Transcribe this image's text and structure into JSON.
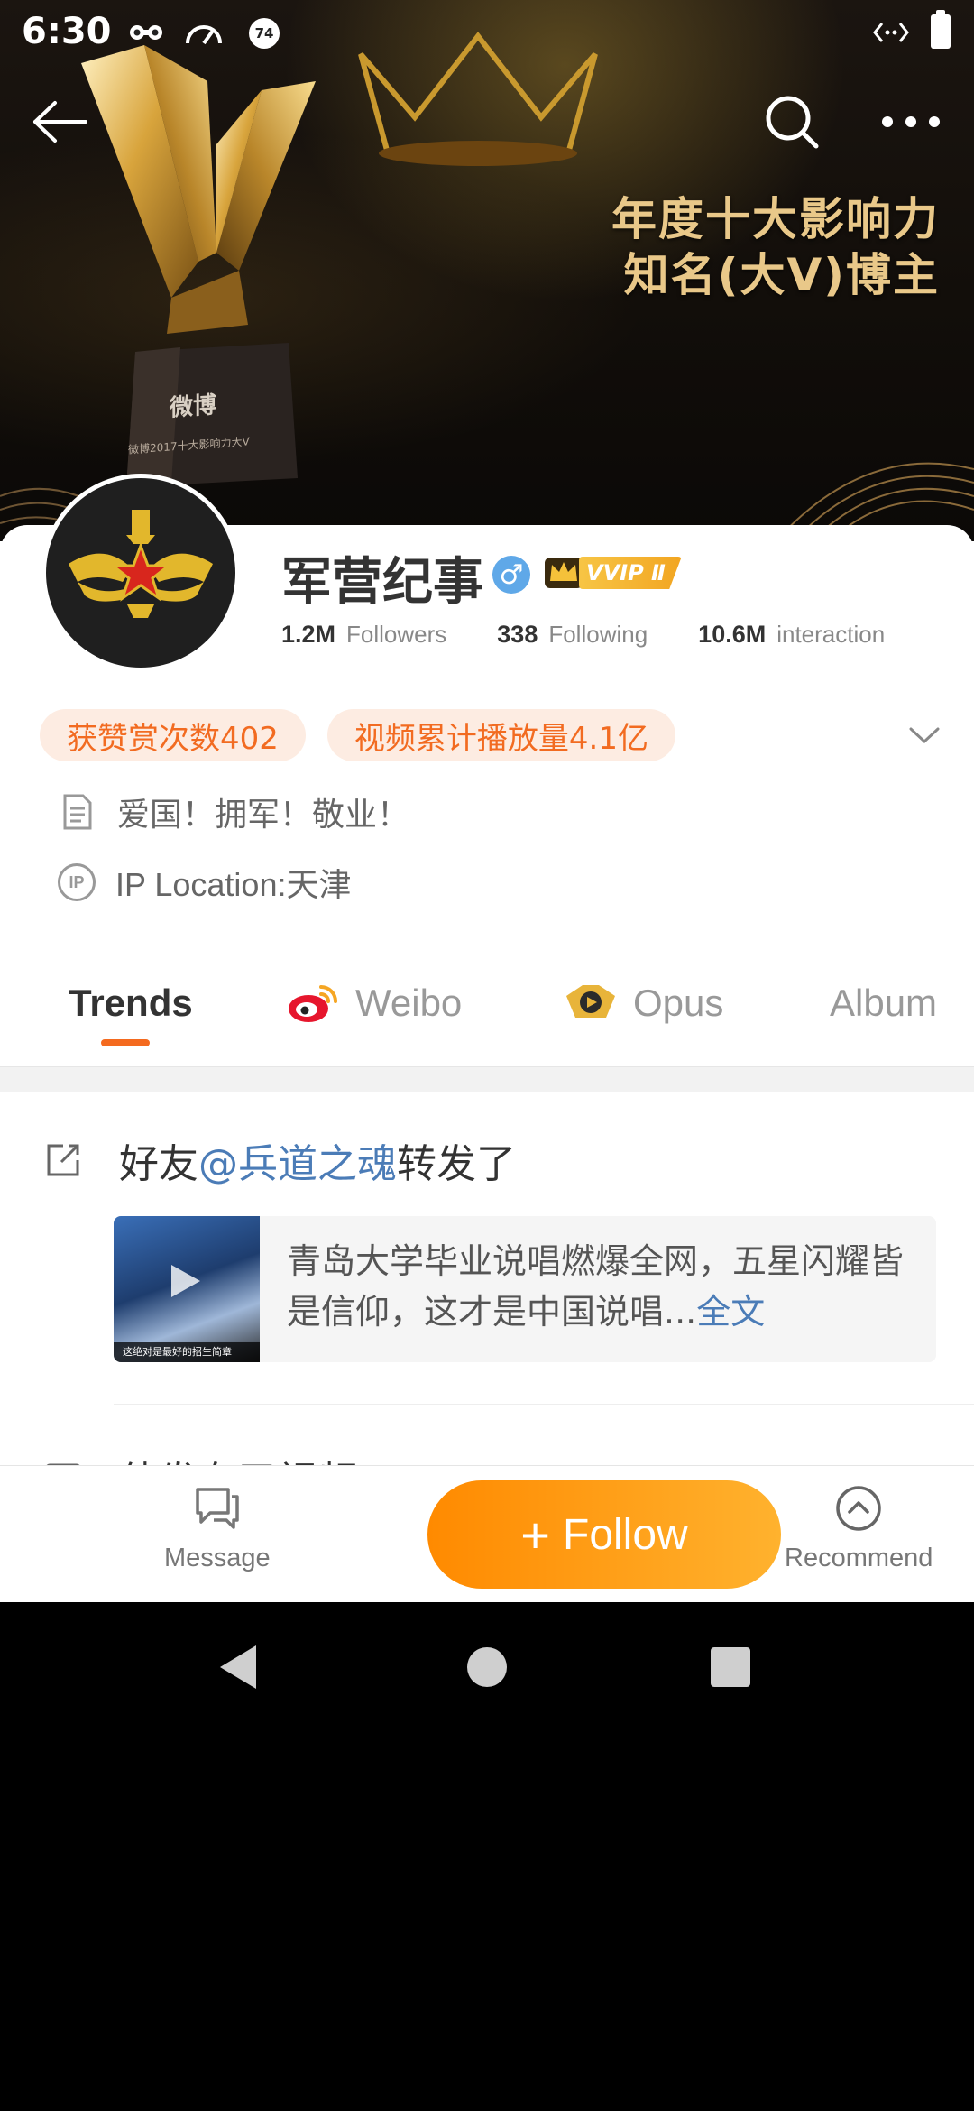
{
  "status_bar": {
    "time": "6:30",
    "badge_number": "74"
  },
  "banner": {
    "award_line1": "年度十大影响力",
    "award_line2": "知名(大V)博主",
    "trophy_brand": "微博",
    "trophy_plaque": "微博2017十大影响力大V"
  },
  "profile": {
    "name": "军营纪事",
    "gender_symbol": "♂",
    "vip_label": "VVIP Ⅱ",
    "stats": [
      {
        "value": "1.2M",
        "label": "Followers"
      },
      {
        "value": "338",
        "label": "Following"
      },
      {
        "value": "10.6M",
        "label": "interaction"
      }
    ],
    "pills": [
      "获赞赏次数402",
      "视频累计播放量4.1亿"
    ],
    "bio": "爱国！拥军！敬业！",
    "ip_badge": "IP",
    "ip_location": "IP Location:天津"
  },
  "tabs": [
    "Trends",
    "Weibo",
    "Opus",
    "Album"
  ],
  "feed": {
    "head_prefix": "好友",
    "head_mention": "@兵道之魂",
    "head_suffix": "转发了",
    "card_text": "青岛大学毕业说唱燃爆全网，五星闪耀皆是信仰，这才是中国说唱...",
    "card_more": "全文",
    "thumb_caption": "这绝对是最好的招生简章",
    "next_head": "他发布了视频"
  },
  "bottom_bar": {
    "message_label": "Message",
    "follow_label": "Follow",
    "recommend_label": "Recommend"
  },
  "colors": {
    "accent_orange": "#f46a1f",
    "link_blue": "#4b7cb7",
    "pill_bg": "#fdece2",
    "follow_gradient_start": "#ff8a00",
    "follow_gradient_end": "#ffb22e"
  }
}
